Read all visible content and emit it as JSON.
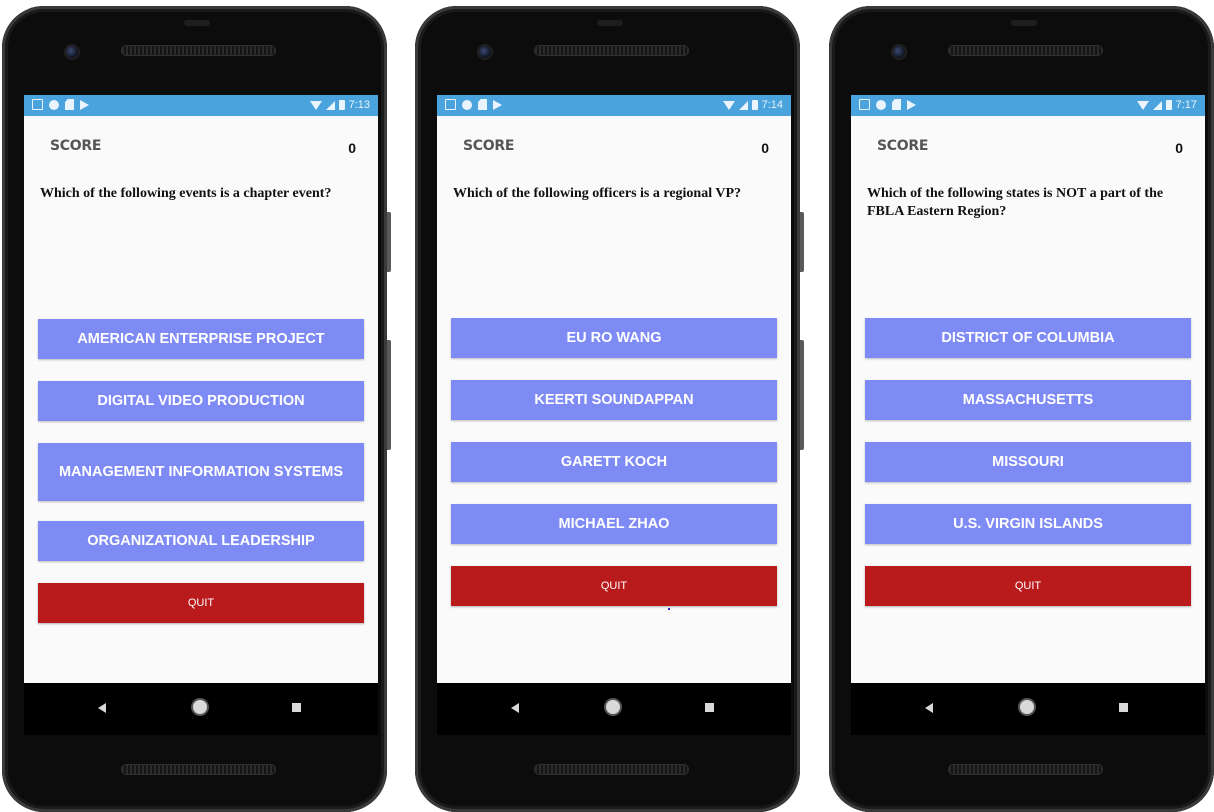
{
  "colors": {
    "status_bar": "#4aa3dd",
    "answer_button": "#7f8bf5",
    "quit_button": "#b91b1d",
    "screen_bg": "#fafafa"
  },
  "screens": [
    {
      "status_time": "7:13",
      "score_label": "SCORE",
      "score_value": "0",
      "question": "Which of the following events is a chapter event?",
      "answers": [
        "AMERICAN ENTERPRISE PROJECT",
        "DIGITAL VIDEO PRODUCTION",
        "MANAGEMENT INFORMATION SYSTEMS",
        "ORGANIZATIONAL LEADERSHIP"
      ],
      "quit_label": "QUIT"
    },
    {
      "status_time": "7:14",
      "score_label": "SCORE",
      "score_value": "0",
      "question": "Which of the following officers is a regional VP?",
      "answers": [
        "EU RO WANG",
        "KEERTI SOUNDAPPAN",
        "GARETT KOCH",
        "MICHAEL ZHAO"
      ],
      "quit_label": "QUIT"
    },
    {
      "status_time": "7:17",
      "score_label": "SCORE",
      "score_value": "0",
      "question": "Which of the following states is NOT a part of the FBLA Eastern Region?",
      "answers": [
        "DISTRICT OF COLUMBIA",
        "MASSACHUSETTS",
        "MISSOURI",
        "U.S. VIRGIN ISLANDS"
      ],
      "quit_label": "QUIT"
    }
  ],
  "status_icons": [
    "gmail-icon",
    "circle-icon",
    "sd-card-icon",
    "play-store-icon",
    "wifi-icon",
    "signal-icon",
    "battery-icon"
  ],
  "nav_icons": [
    "back-icon",
    "home-icon",
    "recents-icon"
  ]
}
